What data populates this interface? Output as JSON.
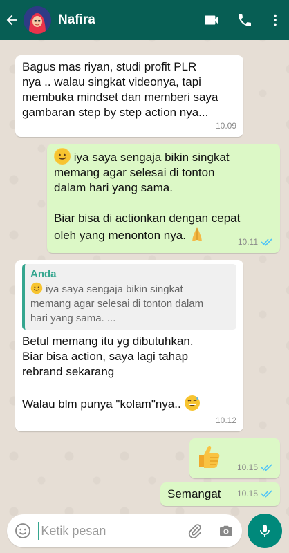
{
  "colors": {
    "header": "#075e54",
    "incoming": "#ffffff",
    "outgoing": "#dcf8c6",
    "read_ticks": "#4fc3f7",
    "accent": "#00897b"
  },
  "header": {
    "contact_name": "Nafira",
    "icons": [
      "back-arrow-icon",
      "video-call-icon",
      "phone-icon",
      "more-vert-icon"
    ]
  },
  "messages": [
    {
      "direction": "in",
      "text": "Bagus mas riyan, studi profit PLR\nnya .. walau singkat videonya, tapi\nmembuka mindset dan memberi saya\ngambaran step by step action nya...",
      "time": "10.09"
    },
    {
      "direction": "out",
      "text_1": "iya saya sengaja bikin singkat\nmemang agar selesai di tonton\ndalam hari yang sama.",
      "text_2": "Biar bisa di actionkan dengan cepat\noleh yang menonton nya.",
      "time": "10.11",
      "status": "read"
    },
    {
      "direction": "in",
      "quote_author": "Anda",
      "quote_text": "iya saya sengaja bikin singkat\nmemang agar selesai di tonton dalam\nhari yang sama. ...",
      "text_1": "Betul memang itu yg dibutuhkan.\nBiar bisa action, saya lagi tahap\nrebrand sekarang",
      "text_2": "Walau blm punya \"kolam\"nya..",
      "time": "10.12"
    },
    {
      "direction": "out",
      "emoji": "thumbs-up-icon",
      "time": "10.15",
      "status": "read"
    },
    {
      "direction": "out",
      "text": "Semangat",
      "time": "10.15",
      "status": "read"
    }
  ],
  "composer": {
    "placeholder": "Ketik pesan",
    "icons": [
      "emoji-icon",
      "attach-icon",
      "camera-icon",
      "mic-icon"
    ]
  }
}
